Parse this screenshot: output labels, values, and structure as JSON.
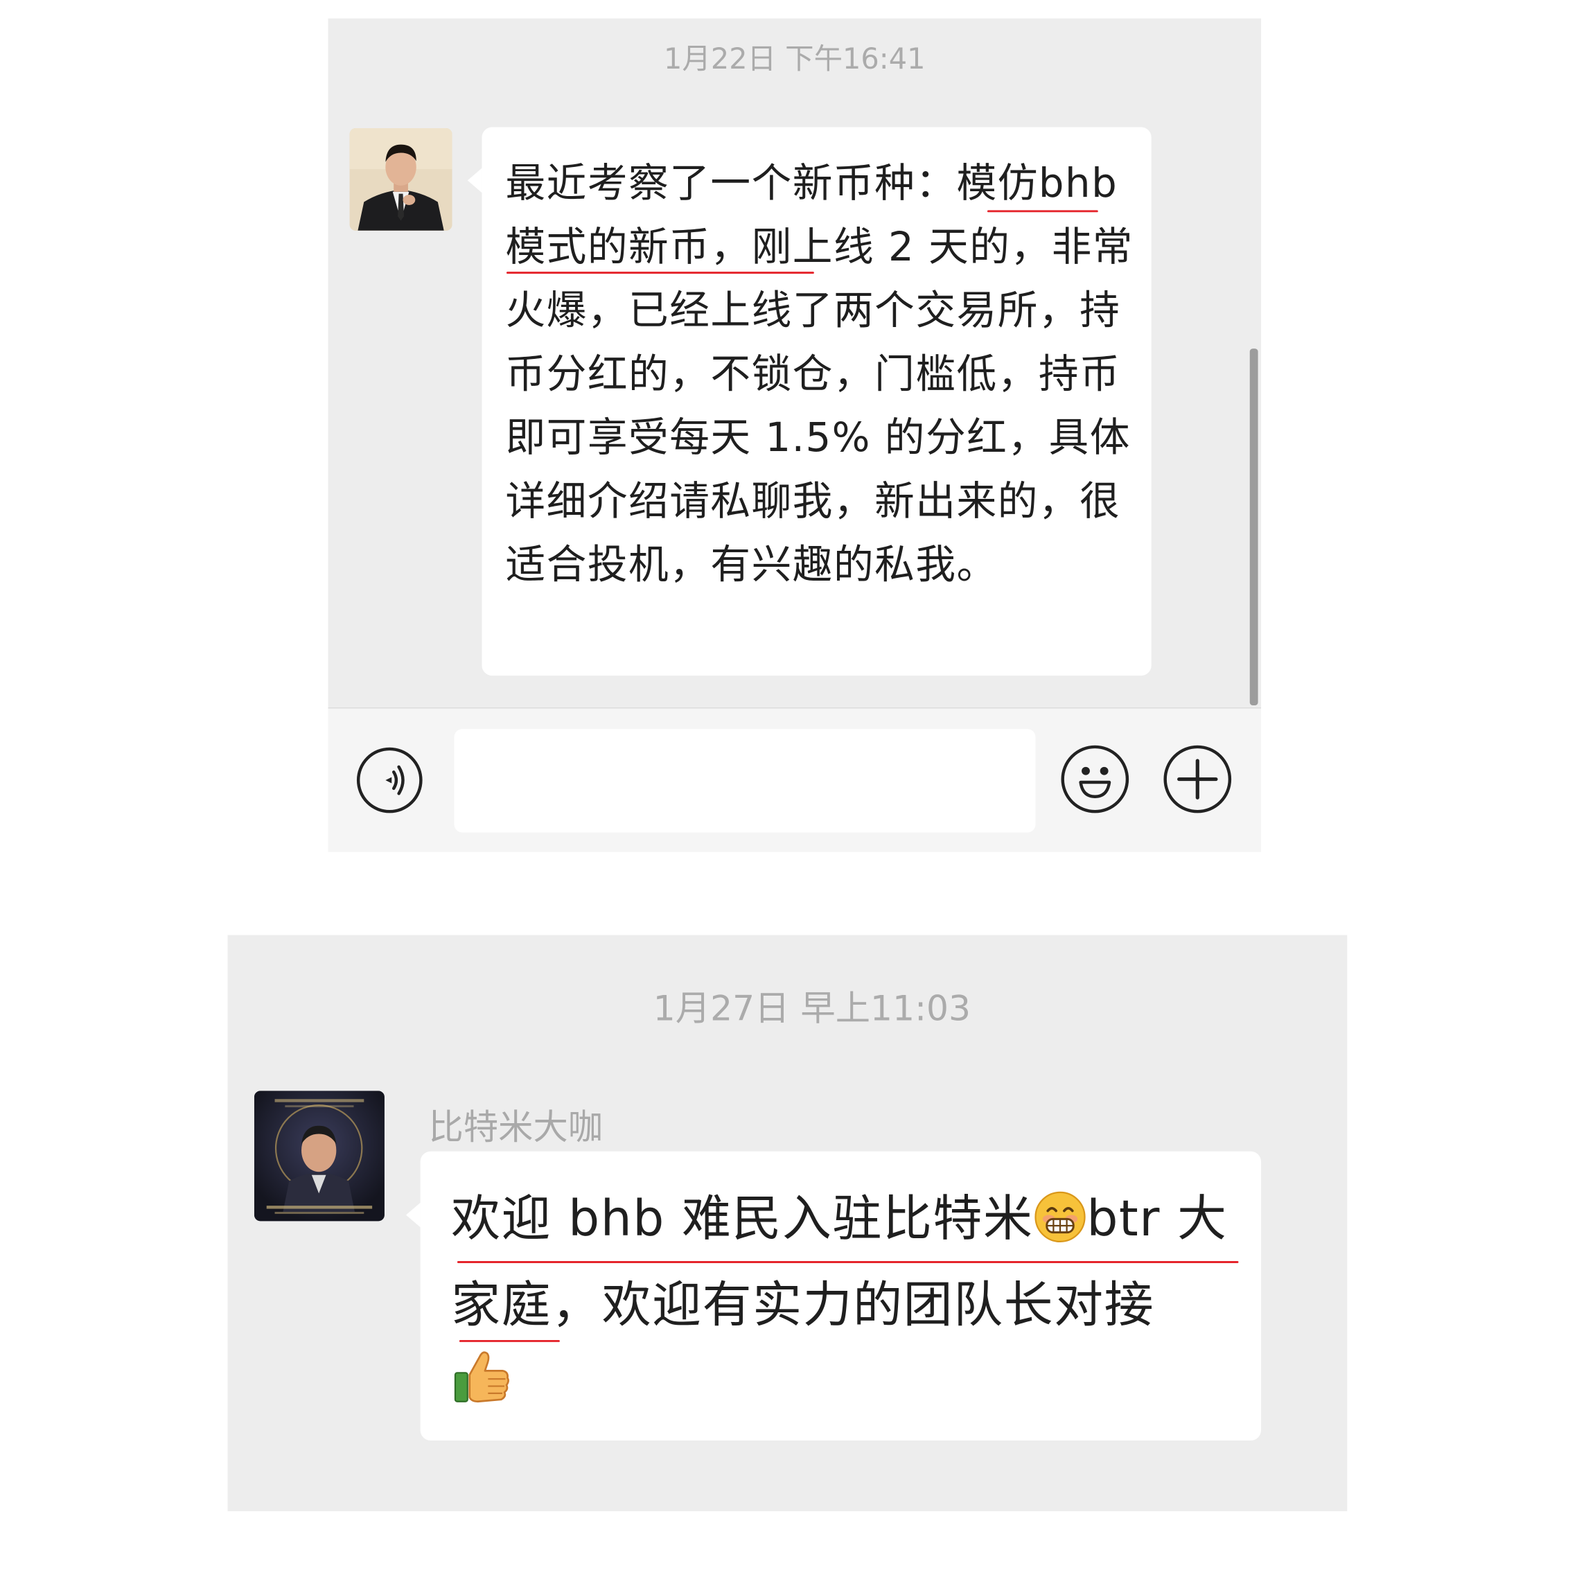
{
  "chat1": {
    "timestamp": "1月22日 下午16:41",
    "message": "最近考察了一个新币种：模仿bhb 模式的新币，刚上线 2 天的，非常火爆，已经上线了两个交易所，持币分红的，不锁仓，门槛低，持币即可享受每天 1.5% 的分红，具体详细介绍请私聊我，新出来的，很适合投机，有兴趣的私我。",
    "avatar_icon": "person-in-suit-avatar",
    "input": {
      "value": "",
      "voice_icon": "voice-icon",
      "emoji_icon": "smiley-icon",
      "add_icon": "plus-icon"
    }
  },
  "chat2": {
    "timestamp": "1月27日 早上11:03",
    "sender": "比特米大咖",
    "avatar_icon": "man-portrait-poster-avatar",
    "message_part1": "欢迎 bhb 难民入驻比特米",
    "message_part2": "btr 大家庭，欢迎有实力的团队长对接",
    "emoji_grin": "grinning-face-emoji",
    "emoji_thumb": "thumbs-up-emoji"
  },
  "colors": {
    "chat_bg": "#ededed",
    "bubble_bg": "#ffffff",
    "underline_red": "#e5252c",
    "timestamp_gray": "#ababab"
  }
}
